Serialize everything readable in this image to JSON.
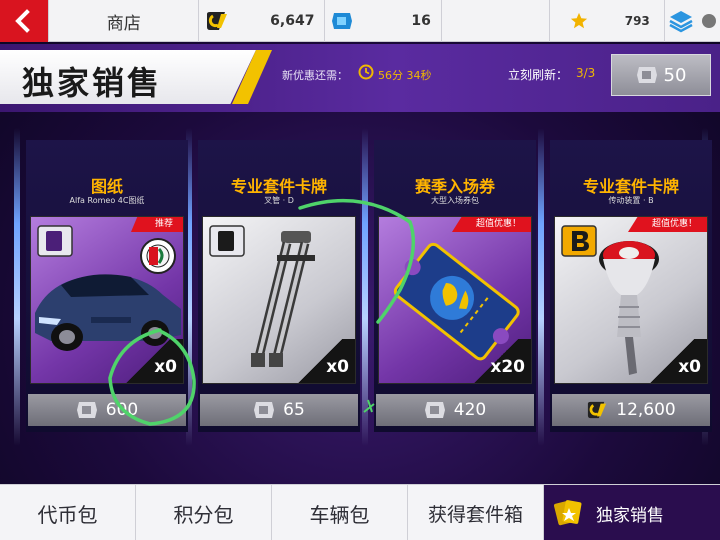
{
  "topbar": {
    "shop_label": "商店",
    "credits": "6,647",
    "tokens": "16",
    "stars": "793"
  },
  "header": {
    "title": "独家销售",
    "offer_label": "新优惠还需：",
    "timer": "56分 34秒",
    "refresh_label": "立刻刷新：",
    "refresh_count": "3/3",
    "refresh_cost": "50"
  },
  "cards": [
    {
      "title": "图纸",
      "subtitle": "Alfa Romeo 4C图纸",
      "ribbon": "推荐",
      "badge": "D",
      "qty": "x0",
      "price": "600",
      "currency": "token-icon"
    },
    {
      "title": "专业套件卡牌",
      "subtitle": "叉管 · D",
      "ribbon": "",
      "badge": "D",
      "qty": "x0",
      "price": "65",
      "currency": "token-icon"
    },
    {
      "title": "赛季入场券",
      "subtitle": "大型入场券包",
      "ribbon": "超值优惠！",
      "badge": "",
      "qty": "x20",
      "price": "420",
      "currency": "token-icon"
    },
    {
      "title": "专业套件卡牌",
      "subtitle": "传动装置 · B",
      "ribbon": "超值优惠！",
      "badge": "B",
      "qty": "x0",
      "price": "12,600",
      "currency": "credit-icon"
    }
  ],
  "bottom_tabs": [
    "代币包",
    "积分包",
    "车辆包",
    "获得套件箱",
    "独家销售"
  ],
  "colors": {
    "accent_red": "#e0121e",
    "gold": "#ffb400",
    "purple_bg": "#2a0d4e"
  }
}
